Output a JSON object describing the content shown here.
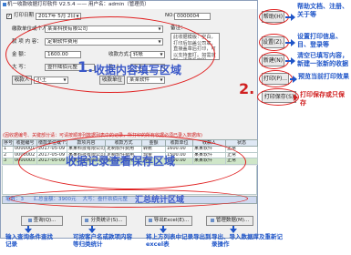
{
  "window": {
    "title": "机一收款收据打印软件 V2.5.4 —— 用户名：admin（管理员）"
  },
  "form": {
    "print_date_checkbox": "打印日期",
    "print_date_value": "2017年 5月 2日",
    "no_label": "NO:",
    "no_value": "0000004",
    "company_label": "缴款单位或个人：",
    "company_value": "某某科技有限公司",
    "item_label": "款  项  内  容：",
    "item_value": "定制软件费用",
    "amount_label": "金        额：",
    "amount_value": "1600.00",
    "method_label": "收款方式：",
    "method_value": "转账",
    "capital_label": "大  写：",
    "capital_value": "壹仟陆佰元整",
    "approver_label": "款  人：",
    "approver_value": "小王",
    "payee_btn": "收款人",
    "payee_value": "小王",
    "remark_label": "备注：",
    "remark_text": "此收据模版：空白，打印后加盖公司章，直接盖章后打印，可以支持套打。如需定制：请联系客服。",
    "unit_btn": "收款单位",
    "unit_value": "某某软件"
  },
  "notice": "(因收据编号、关键部分请：可请按顺排列数据列表中的记录，所打印的所有收据必须已录入数据库)",
  "table": {
    "headers": [
      "序号",
      "收据编号",
      "缴款单位或个人",
      "款项内容",
      "收款方式",
      "金额",
      "收款单位",
      "收款人",
      "状态"
    ],
    "rows": [
      [
        "1",
        "0000001",
        "2017-05-09",
        "某某科技有限公司",
        "定制软件费用",
        "转账",
        "1600.00",
        "某某软件",
        "正常"
      ],
      [
        "2",
        "0000002",
        "2017-05-09",
        "某某科技有限公司",
        "定制软件费用",
        "现金",
        "1500.00",
        "某某软件",
        "正常"
      ],
      [
        "3",
        "0000003",
        "2017-05-09",
        "某某科技有限公司",
        "定制软件费用",
        "转账",
        "1600.00",
        "某某软件",
        "正常"
      ]
    ]
  },
  "status": {
    "count_label": "笔数：3",
    "total_label": "汇总金额：3900元",
    "capital_label": "大写：叁仟玖佰元整",
    "annotation": "汇总统计区域"
  },
  "bottom_buttons": [
    "查询(Q)...",
    "分类统计(S)...",
    "导出Excel(E)...",
    "管理数据(M)..."
  ],
  "side_buttons": [
    "帮助(H)",
    "设置(Z)...",
    "新建(N)",
    "打印(P)...",
    "打印保存(S)"
  ],
  "annotations": {
    "area1": "收据内容填写区域",
    "area1_num": "1.",
    "area2_num": "2.",
    "records": "收据记录查看保存区域",
    "help": "帮助文档、注册、关于等",
    "settings": "设置打印信息、目、登录等",
    "new": "清空已填写内容，新建一张新的收据",
    "print_preview": "预览当前打印效果",
    "print_save": "打印保存或只保存",
    "query": "输入查询条件查找记录",
    "stats": "可按客户名或款项内容等归类统计",
    "export": "将上方列表中记录导出到excel表",
    "manage": "导出、导入数据库及重新记录操作"
  }
}
